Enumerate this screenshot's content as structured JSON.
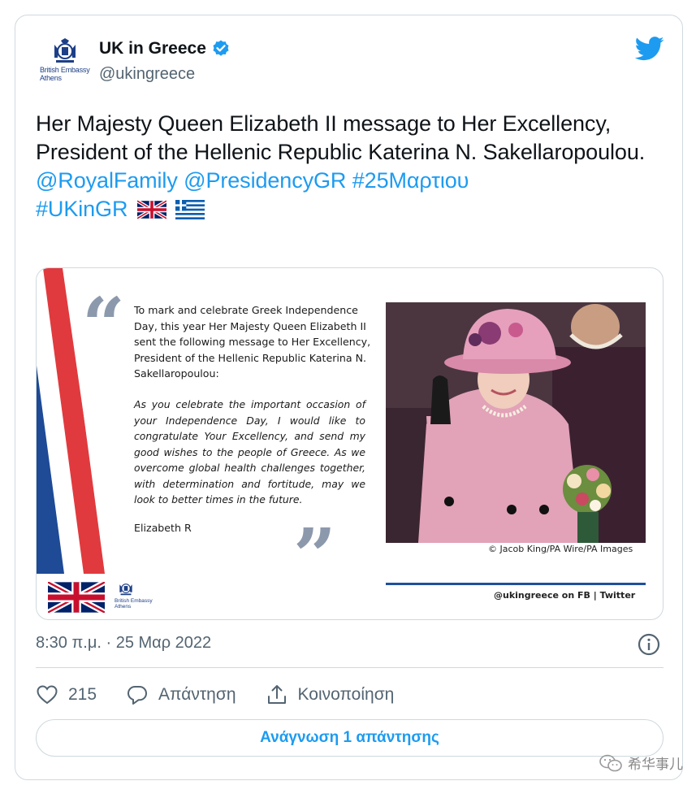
{
  "author": {
    "avatar_caption": "British Embassy Athens",
    "display_name": "UK in Greece",
    "handle": "@ukingreece"
  },
  "tweet": {
    "text_line": "Her Majesty Queen Elizabeth II message to Her Excellency, President of the Hellenic Republic Katerina N. Sakellaropoulou.",
    "mention_1": "@RoyalFamily",
    "mention_2": "@PresidencyGR",
    "hashtag_1": "#25Μαρτιου",
    "hashtag_2": "#UKinGR"
  },
  "media": {
    "intro": "To mark and celebrate Greek Independence Day, this year Her Majesty Queen Elizabeth II sent the following message to Her Excellency, President of the Hellenic Republic Katerina N. Sakellaropoulou:",
    "body": "As you celebrate the important occasion of your Independence Day, I would like to congratulate Your Excellency, and send my good wishes to the people of Greece. As we overcome global health challenges together, with determination and fortitude, may we look to better times in the future.",
    "signature": "Elizabeth R",
    "photo_credit": "© Jacob King/PA Wire/PA Images",
    "social_credit": "@ukingreece on FB | Twitter",
    "embassy_caption": "British Embassy Athens"
  },
  "timestamp": "8:30 π.μ. · 25 Μαρ 2022",
  "actions": {
    "likes": "215",
    "reply_label": "Απάντηση",
    "share_label": "Κοινοποίηση"
  },
  "read_replies_label": "Ανάγνωση 1 απάντησης",
  "watermark": "希华事儿",
  "colors": {
    "link": "#1d9bf0",
    "text": "#0f1419",
    "secondary": "#536471",
    "border": "#cfd9de"
  }
}
